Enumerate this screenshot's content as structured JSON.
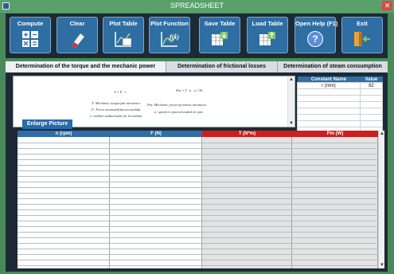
{
  "window": {
    "title": "SPREADSHEET",
    "close_icon": "close-icon"
  },
  "toolbar": [
    {
      "label": "Compute",
      "icon": "calculator-icon"
    },
    {
      "label": "Clear",
      "icon": "eraser-icon"
    },
    {
      "label": "Plot Table",
      "icon": "chart-table-icon"
    },
    {
      "label": "Plot Function",
      "icon": "function-chart-icon",
      "icon_text": "f(x)"
    },
    {
      "label": "Save Table",
      "icon": "save-table-icon"
    },
    {
      "label": "Load Table",
      "icon": "load-table-icon"
    },
    {
      "label": "Open Help (F1)",
      "icon": "help-icon",
      "icon_text": "?"
    },
    {
      "label": "Exit",
      "icon": "exit-icon"
    }
  ],
  "tabs": [
    {
      "label": "Determination of the torque and the mechanic power",
      "active": true
    },
    {
      "label": "Determination of frictional losses",
      "active": false
    },
    {
      "label": "Determination of steam consumption",
      "active": false
    }
  ],
  "formulas": {
    "eq1": "T = F · r",
    "eq2": "Pm = T · n · π / 30",
    "t_def": "T: Mechanic torque/par mecánico",
    "f_def": "F: Force measured/fuerza medida",
    "r_def": "r: turbine radius/radio de la turbina",
    "pm_def": "Pm: Mechanic power/potencia mecánica",
    "n_def": "n: speed in rpm/velocidad en rpm"
  },
  "enlarge_button": "Enlarge Picture",
  "constants": {
    "headers": [
      "Constant Name",
      "Value"
    ],
    "rows": [
      [
        "r (mm)",
        "82"
      ],
      [
        "",
        ""
      ],
      [
        "",
        ""
      ],
      [
        "",
        ""
      ],
      [
        "",
        ""
      ],
      [
        "",
        ""
      ],
      [
        "",
        ""
      ],
      [
        "",
        ""
      ]
    ]
  },
  "grid": {
    "columns": [
      {
        "label": "n (rpm)",
        "color": "#2f6ea6"
      },
      {
        "label": "F (N)",
        "color": "#2f6ea6"
      },
      {
        "label": "T (N*m)",
        "color": "#cc1f1f"
      },
      {
        "label": "Pm (W)",
        "color": "#cc1f1f"
      }
    ]
  },
  "colors": {
    "accent_blue": "#2f6ea6",
    "accent_red": "#cc1f1f",
    "window_green": "#5aa06a"
  }
}
